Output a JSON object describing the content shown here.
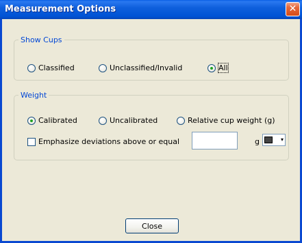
{
  "window": {
    "title": "Measurement Options",
    "close_glyph": "✕"
  },
  "show_cups": {
    "legend": "Show Cups",
    "options": [
      {
        "label": "Classified",
        "checked": false
      },
      {
        "label": "Unclassified/Invalid",
        "checked": false
      },
      {
        "label": "All",
        "checked": true
      }
    ]
  },
  "weight": {
    "legend": "Weight",
    "options": [
      {
        "label": "Calibrated",
        "checked": true
      },
      {
        "label": "Uncalibrated",
        "checked": false
      },
      {
        "label": "Relative cup weight (g)",
        "checked": false
      }
    ],
    "emphasize_label": "Emphasize deviations above or equal",
    "emphasize_checked": false,
    "threshold_value": "",
    "unit": "g",
    "color_arrow": "▾",
    "color_value": "#444444"
  },
  "footer": {
    "close_label": "Close"
  },
  "icons": {
    "close": "close-icon",
    "dropdown": "chevron-down-icon"
  }
}
